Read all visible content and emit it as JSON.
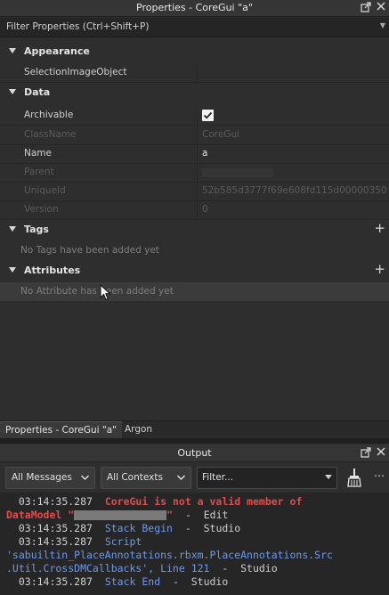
{
  "window": {
    "title": "Properties - CoreGui \"a\""
  },
  "filter": {
    "placeholder": "Filter Properties (Ctrl+Shift+P)"
  },
  "sections": {
    "appearance": "Appearance",
    "data": "Data",
    "tags": "Tags",
    "attributes": "Attributes"
  },
  "properties": {
    "selection_image_object": {
      "name": "SelectionImageObject",
      "value": ""
    },
    "archivable": {
      "name": "Archivable",
      "checked": true
    },
    "class_name": {
      "name": "ClassName",
      "value": "CoreGui"
    },
    "name": {
      "name": "Name",
      "value": "a"
    },
    "parent": {
      "name": "Parent",
      "value": ""
    },
    "unique_id": {
      "name": "UniqueId",
      "value": "52b585d3777f69e608fd115d00000350"
    },
    "version": {
      "name": "Version",
      "value": "0"
    }
  },
  "tags_empty": "No Tags have been added yet",
  "attributes_empty": "No Attribute has been added yet",
  "bottom_tabs": [
    "Properties - CoreGui \"a\"",
    "Argon"
  ],
  "output": {
    "title": "Output",
    "messages_filter": "All Messages",
    "contexts_filter": "All Contexts",
    "filter_placeholder": "Filter...",
    "log": {
      "l1_time": "03:14:35.287",
      "l1_msg": "CoreGui is not a valid member of",
      "l2_start": "DataModel \"",
      "l2_end": "\"",
      "l2_suffix": "  -  Edit",
      "l3_time": "03:14:35.287",
      "l3_msg": "Stack Begin",
      "l3_suffix": "  -  Studio",
      "l4_time": "03:14:35.287",
      "l4_msg": "Script",
      "l5": "'sabuiltin_PlaceAnnotations.rbxm.PlaceAnnotations.Src",
      "l6_msg": ".Util.CrossDMCallbacks', Line 121",
      "l6_suffix": "  -  Studio",
      "l7_time": "03:14:35.287",
      "l7_msg": "Stack End",
      "l7_suffix": "  -  Studio"
    }
  },
  "colors": {
    "error": "#e24c4c",
    "info": "#6f99e8"
  }
}
